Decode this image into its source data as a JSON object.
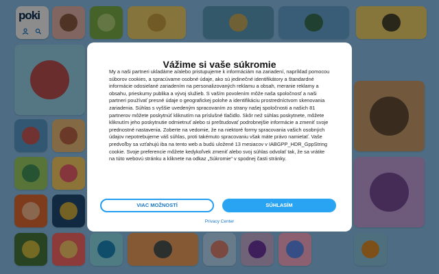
{
  "site": {
    "logo_text": "poki"
  },
  "colors": {
    "background": "#8fc7f0",
    "accent": "#28a4f2",
    "link": "#1677c9"
  },
  "logo_icons": [
    "user-icon",
    "search-icon"
  ],
  "tiles": [
    {
      "c": "#e9b9b0",
      "k": "#7a4a2c"
    },
    {
      "c": "#7fb44c",
      "k": "#c2e08a"
    },
    {
      "c": "#f2d36c",
      "k": "#c79a3c"
    },
    {
      "c": "#5ea0c0",
      "k": "#e8b44b"
    },
    {
      "c": "#6ba9d9",
      "k": "#2f6a3a"
    },
    {
      "c": "#f6d76c",
      "k": "#222222"
    },
    {
      "c": "#9bd9f0",
      "k": "#c9302c"
    },
    {
      "c": "#f3a8c6",
      "k": "#e5599a"
    },
    {
      "c": "#e7c69d",
      "k": "#2d2d2d"
    },
    {
      "c": "#cfa36f",
      "k": "#4d3b2b"
    },
    {
      "c": "#5b9fcf",
      "k": "#e84c3d"
    },
    {
      "c": "#f1c27d",
      "k": "#b5533c"
    },
    {
      "c": "#a0d468",
      "k": "#2e8b57"
    },
    {
      "c": "#ffd166",
      "k": "#ef476f"
    },
    {
      "c": "#9fdcf2",
      "k": "#3b7bd9"
    },
    {
      "c": "#c9a4e0",
      "k": "#6c3b8f"
    },
    {
      "c": "#e86e35",
      "k": "#ffd2a8"
    },
    {
      "c": "#1f4e79",
      "k": "#ffcc33"
    },
    {
      "c": "#4a7b3f",
      "k": "#f5d442"
    },
    {
      "c": "#ff6b6b",
      "k": "#ffe66d"
    },
    {
      "c": "#90e0ef",
      "k": "#0077b6"
    },
    {
      "c": "#f4a261",
      "k": "#264653"
    },
    {
      "c": "#bde0fe",
      "k": "#e76f51"
    },
    {
      "c": "#cdb4db",
      "k": "#5a189a"
    },
    {
      "c": "#ffafcc",
      "k": "#3a86ff"
    },
    {
      "c": "#8ecae6",
      "k": "#fb8500"
    }
  ],
  "dialog": {
    "title": "Vážime si vaše súkromie",
    "body": "My a naši partneri ukladáme a/alebo pristupujeme k informáciám na zariadení, napríklad pomocou súborov cookies, a spracúvame osobné údaje, ako sú jedinečné identifikátory a štandardné informácie odosielané zariadením na personalizovaných reklamu a obsah, meranie reklamy a obsahu, prieskumy publika a vývoj služieb. S vaším povolením môže naša spoločnosť a naši partneri používať presné údaje o geografickej polohe a identifikáciu prostredníctvom skenovania zariadenia. Súhlas s vyššie uvedeným spracovaním zo strany našej spoločnosti a našich 81 partnerov môžete poskytnúť kliknutím na príslušné tlačidlo. Skôr než súhlas poskytnete, môžete kliknutím jeho poskytnutie odmietnuť alebo si preštudovať podrobnejšie informácie a zmeniť svoje prednostné nastavenia. Zoberte na vedomie, že na niektoré formy spracovania vašich osobných údajov nepotrebujeme váš súhlas, proti takémuto spracovaniu však máte právo namietať. Vaše predvoľby sa vzťahujú iba na tento web a budú uložené 13 mesiacov v IABGPP_HDR_GppString cookie. Svoje preferencie môžete kedykoľvek zmeniť alebo svoj súhlas odvolať tak, že sa vrátite na túto webovú stránku a kliknete na odkaz „Súkromie“ v spodnej časti stránky.",
    "more_label": "VIAC MOŽNOSTÍ",
    "agree_label": "SÚHLASÍM",
    "privacy_label": "Privacy Center"
  }
}
